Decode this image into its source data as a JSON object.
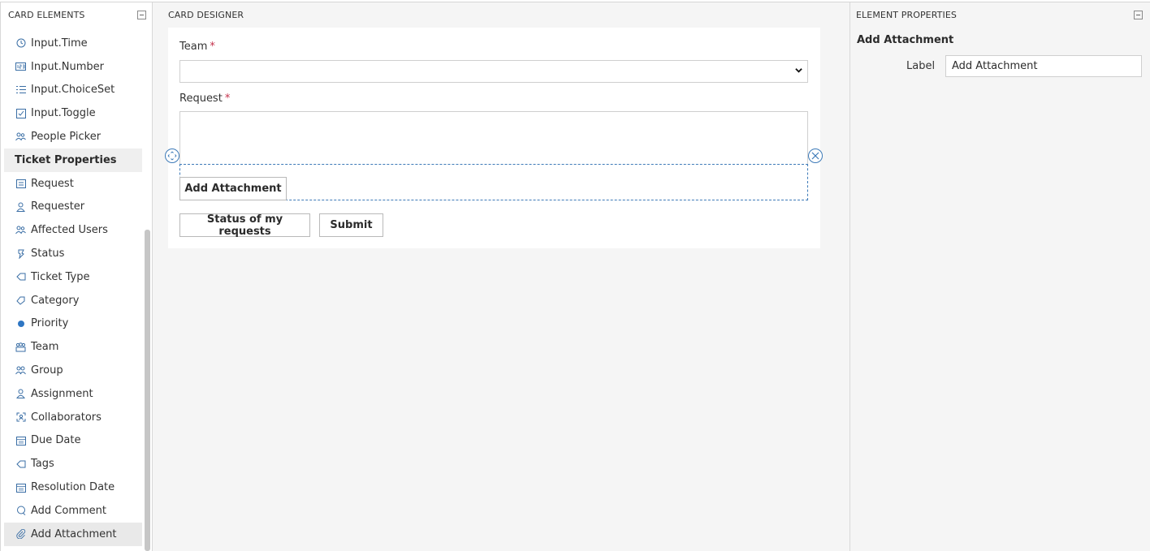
{
  "left_panel": {
    "title": "CARD ELEMENTS",
    "items": [
      {
        "label": "Input.Time",
        "icon": "clock-icon"
      },
      {
        "label": "Input.Number",
        "icon": "number-icon"
      },
      {
        "label": "Input.ChoiceSet",
        "icon": "list-icon"
      },
      {
        "label": "Input.Toggle",
        "icon": "checkbox-icon"
      },
      {
        "label": "People Picker",
        "icon": "people-icon"
      },
      {
        "label": "Ticket Properties",
        "section": true
      },
      {
        "label": "Request",
        "icon": "request-icon"
      },
      {
        "label": "Requester",
        "icon": "person-icon"
      },
      {
        "label": "Affected Users",
        "icon": "people-icon"
      },
      {
        "label": "Status",
        "icon": "status-icon"
      },
      {
        "label": "Ticket Type",
        "icon": "tag-icon"
      },
      {
        "label": "Category",
        "icon": "category-icon"
      },
      {
        "label": "Priority",
        "icon": "dot-icon"
      },
      {
        "label": "Team",
        "icon": "team-icon"
      },
      {
        "label": "Group",
        "icon": "group-icon"
      },
      {
        "label": "Assignment",
        "icon": "person-icon"
      },
      {
        "label": "Collaborators",
        "icon": "collaborators-icon"
      },
      {
        "label": "Due Date",
        "icon": "calendar-icon"
      },
      {
        "label": "Tags",
        "icon": "tag-icon"
      },
      {
        "label": "Resolution Date",
        "icon": "calendar-icon"
      },
      {
        "label": "Add Comment",
        "icon": "comment-icon"
      },
      {
        "label": "Add Attachment",
        "icon": "paperclip-icon",
        "selected": true
      }
    ]
  },
  "center": {
    "title": "CARD DESIGNER",
    "team_label": "Team",
    "request_label": "Request",
    "required_marker": "*",
    "attachment_button": "Add Attachment",
    "status_button": "Status of my requests",
    "submit_button": "Submit"
  },
  "right_panel": {
    "title": "ELEMENT PROPERTIES",
    "heading": "Add Attachment",
    "label_name": "Label",
    "label_value": "Add Attachment"
  },
  "colors": {
    "accent": "#3d7ab8",
    "required": "#c4314b"
  }
}
